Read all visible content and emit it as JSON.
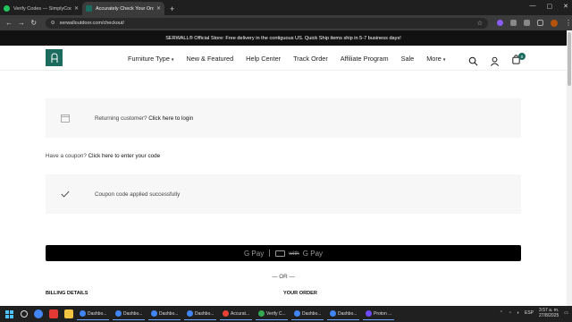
{
  "browser": {
    "tabs": [
      {
        "title": "Verify Codes — SimplyCodes",
        "favicon_color": "#22c55e",
        "active": false
      },
      {
        "title": "Accurately Check Your Order In",
        "favicon_color": "#1b6b5f",
        "active": true
      }
    ],
    "new_tab_label": "+",
    "url": "serwalloutdoor.com/checkout/"
  },
  "announcement": "SERWALL® Official Store: Free delivery in the contiguous US. Quick Ship items ship in 5-7 business days!",
  "nav": {
    "items": [
      {
        "label": "Furniture Type",
        "has_caret": true
      },
      {
        "label": "New & Featured",
        "has_caret": false
      },
      {
        "label": "Help Center",
        "has_caret": false
      },
      {
        "label": "Track Order",
        "has_caret": false
      },
      {
        "label": "Affiliate Program",
        "has_caret": false
      },
      {
        "label": "Sale",
        "has_caret": false
      },
      {
        "label": "More",
        "has_caret": true
      }
    ],
    "cart_count": "0"
  },
  "returning": {
    "prefix": "Returning customer?",
    "link": "Click here to login"
  },
  "coupon": {
    "prefix": "Have a coupon?",
    "link": "Click here to enter your code"
  },
  "coupon_notice": "Coupon code applied successfully",
  "gpay": {
    "left": "G Pay",
    "right_with": "with",
    "right_brand": "G Pay"
  },
  "or_divider": "— OR —",
  "billing_title": "BILLING DETAILS",
  "order_title": "YOUR ORDER",
  "taskbar": {
    "apps": [
      {
        "label": "Dashbo...",
        "color": "#4285f4"
      },
      {
        "label": "Dashbo...",
        "color": "#4285f4"
      },
      {
        "label": "Dashbo...",
        "color": "#4285f4"
      },
      {
        "label": "Dashbo...",
        "color": "#4285f4"
      },
      {
        "label": "Accurat...",
        "color": "#ea4335"
      },
      {
        "label": "Verify C...",
        "color": "#34a853"
      },
      {
        "label": "Dashbo...",
        "color": "#4285f4"
      },
      {
        "label": "Dashbo...",
        "color": "#4285f4"
      },
      {
        "label": "Proton ...",
        "color": "#6d4aff"
      }
    ],
    "lang": "ESP",
    "time": "3:57 a. m.",
    "date": "27/8/2025"
  }
}
